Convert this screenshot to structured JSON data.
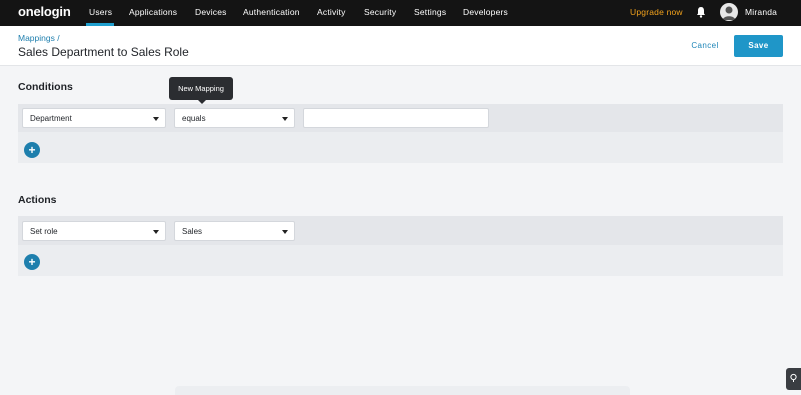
{
  "nav": {
    "logo": "onelogin",
    "items": [
      "Users",
      "Applications",
      "Devices",
      "Authentication",
      "Activity",
      "Security",
      "Settings",
      "Developers"
    ],
    "active_index": 0,
    "upgrade_label": "Upgrade now",
    "user_name": "Miranda"
  },
  "header": {
    "breadcrumb": "Mappings /",
    "title": "Sales Department to Sales Role",
    "cancel_label": "Cancel",
    "save_label": "Save"
  },
  "tooltip": "New Mapping",
  "conditions": {
    "title": "Conditions",
    "field_value": "Department",
    "operator_value": "equals",
    "value_input": ""
  },
  "actions": {
    "title": "Actions",
    "action_value": "Set role",
    "role_value": "Sales"
  },
  "colors": {
    "accent": "#1f96c8",
    "upgrade": "#f4a31c",
    "nav_bg": "#141414"
  }
}
